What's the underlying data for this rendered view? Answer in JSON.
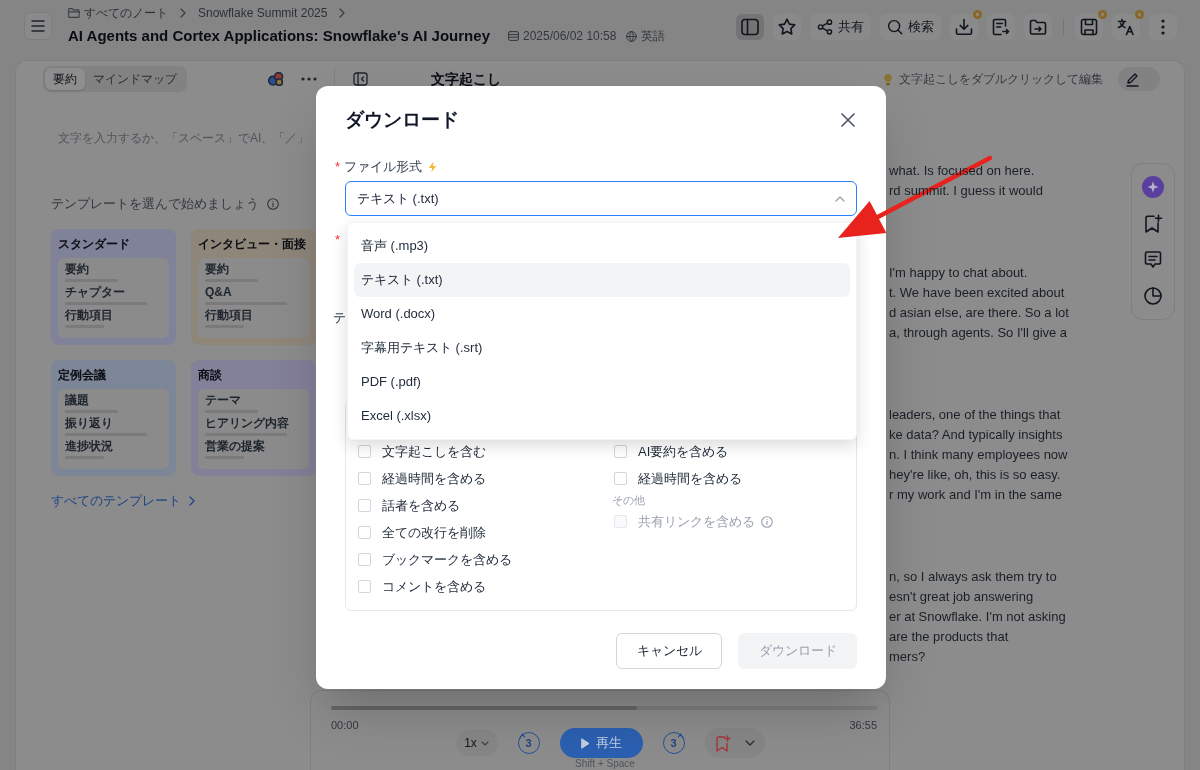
{
  "header": {
    "breadcrumb": [
      "すべてのノート",
      "Snowflake Summit 2025"
    ],
    "title": "AI Agents and Cortex Applications: Snowflake's AI Journey",
    "date": "2025/06/02 10:58",
    "language": "英語",
    "toolbar_groups": [
      [
        {
          "active": true,
          "badge": false
        },
        {
          "active": false,
          "badge": false
        },
        {
          "label": "共有",
          "active": false,
          "badge": false
        },
        {
          "label": "検索",
          "active": false,
          "badge": false
        },
        {
          "active": false,
          "badge": true
        },
        {
          "active": false,
          "badge": false
        },
        {
          "active": false,
          "badge": false
        }
      ],
      [
        {
          "active": false,
          "badge": true
        },
        {
          "active": false,
          "badge": true
        },
        {
          "active": false,
          "badge": false
        }
      ]
    ]
  },
  "summary_panel": {
    "tabs": [
      {
        "label": "要約",
        "selected": true
      },
      {
        "label": "マインドマップ",
        "selected": false
      }
    ],
    "editor": {
      "placeholder": "文字を入力するか、「スペース」でAI、「／」"
    },
    "templates_heading": "テンプレートを選んで始めましょう",
    "templates": [
      {
        "title": "スタンダード",
        "color": "#80829a",
        "items": [
          "要約",
          "チャプター",
          "行動項目"
        ]
      },
      {
        "title": "インタビュー・面接",
        "color": "#8f867a",
        "items": [
          "要約",
          "Q&A",
          "行動項目"
        ]
      },
      {
        "title": "定例会議",
        "color": "#7d8696",
        "items": [
          "議題",
          "振り返り",
          "進捗状況"
        ]
      },
      {
        "title": "商談",
        "color": "#838099",
        "items": [
          "テーマ",
          "ヒアリング内容",
          "営業の提案"
        ]
      }
    ],
    "all_templates_link": "すべてのテンプレート"
  },
  "transcript_panel": {
    "title": "文字起こし",
    "hint": "文字起こしをダブルクリックして編集",
    "edit_toggle": {
      "on": false
    },
    "paragraphs": [
      {
        "lines": [
          "what. Is focused on here.",
          "rd summit. I guess it would"
        ]
      },
      {
        "lines": [
          "I'm happy to chat about.",
          "t. We have been excited about",
          "d asian else, are there. So a lot",
          "a, through agents. So I'll give a"
        ]
      },
      {
        "lines": [
          "leaders, one of the things that",
          "ke data? And typically insights",
          "n. I think many employees now",
          "hey're like, oh, this is so easy.",
          "r my work and I'm in the same"
        ]
      },
      {
        "lines": [
          "n, so I always ask them try to",
          "esn't great job answering",
          "er at Snowflake. I'm not asking",
          "are the products that",
          "mers?"
        ]
      }
    ]
  },
  "player": {
    "level": 0.56,
    "elapsed": "00:00",
    "duration": "36:55",
    "speed": "1x",
    "rewind_seconds": "3",
    "play_label": "再生",
    "forward_seconds": "3",
    "shortcut": "Shift + Space"
  },
  "modal": {
    "title": "ダウンロード",
    "format_field": {
      "mark": "*",
      "label": "ファイル形式",
      "value": "テキスト (.txt)",
      "expanded": true,
      "options": [
        {
          "label": "音声 (.mp3)",
          "selected": false
        },
        {
          "label": "テキスト (.txt)",
          "selected": true
        },
        {
          "label": "Word (.docx)",
          "selected": false
        },
        {
          "label": "字幕用テキスト (.srt)",
          "selected": false
        },
        {
          "label": "PDF (.pdf)",
          "selected": false
        },
        {
          "label": "Excel (.xlsx)",
          "selected": false
        }
      ]
    },
    "field_2": {
      "mark": "*"
    },
    "field_3": {
      "label": "テ"
    },
    "transcript_options": [
      {
        "label": "文字起こしを含む",
        "checked": false,
        "disabled": false
      },
      {
        "label": "経過時間を含める",
        "checked": false,
        "disabled": false
      },
      {
        "label": "話者を含める",
        "checked": false,
        "disabled": false
      },
      {
        "label": "全ての改行を削除",
        "checked": false,
        "disabled": false
      },
      {
        "label": "ブックマークを含める",
        "checked": false,
        "disabled": false
      },
      {
        "label": "コメントを含める",
        "checked": false,
        "disabled": false
      }
    ],
    "summary_options": [
      {
        "label": "AI要約を含める",
        "checked": false,
        "disabled": false
      },
      {
        "label": "経過時間を含める",
        "checked": false,
        "disabled": false
      }
    ],
    "other_heading": "その他",
    "other_options": [
      {
        "label": "共有リンクを含める",
        "checked": false,
        "disabled": true,
        "info": true
      }
    ],
    "buttons": [
      {
        "label": "キャンセル",
        "kind": "secondary",
        "disabled": false
      },
      {
        "label": "ダウンロード",
        "kind": "primary",
        "disabled": true
      }
    ]
  }
}
